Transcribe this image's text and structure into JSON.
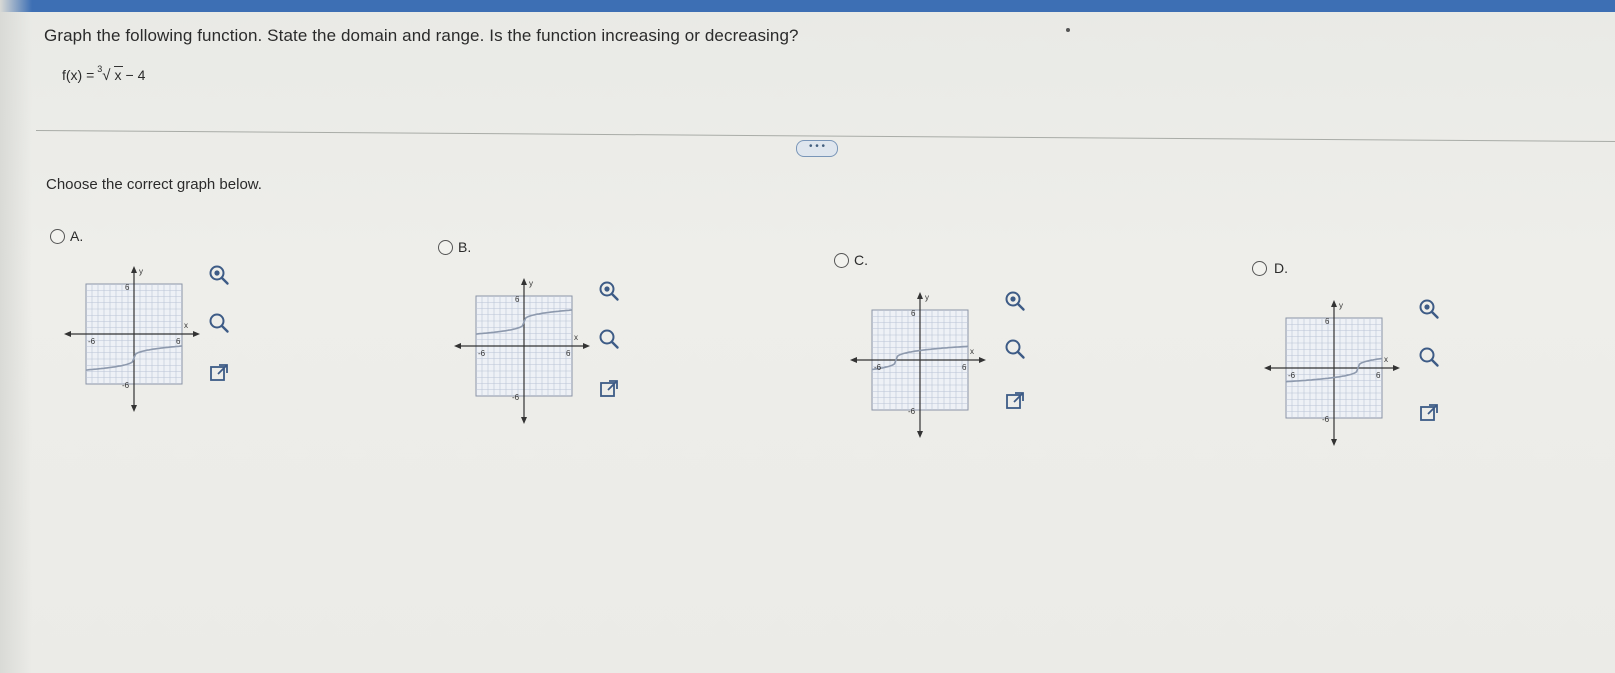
{
  "question": {
    "prompt": "Graph the following function. State the domain and range. Is the function increasing or decreasing?",
    "formula": {
      "lhs": "f(x) =",
      "root_index": "3",
      "radicand": "x",
      "rhs": "− 4"
    },
    "more_button": "• • •",
    "instruction": "Choose the correct graph below."
  },
  "options": [
    {
      "letter": "A.",
      "axis_x": "x",
      "axis_y": "y",
      "tick_pos": "6",
      "tick_neg": "-6"
    },
    {
      "letter": "B.",
      "axis_x": "x",
      "axis_y": "y",
      "tick_pos": "6",
      "tick_neg": "-6"
    },
    {
      "letter": "C.",
      "axis_x": "x",
      "axis_y": "y",
      "tick_pos": "6",
      "tick_neg": "-6"
    },
    {
      "letter": "D.",
      "axis_x": "x",
      "axis_y": "y",
      "tick_pos": "6",
      "tick_neg": "-6"
    }
  ],
  "icons": {
    "zoom_in": "zoom-in-icon",
    "zoom_out": "zoom-out-icon",
    "popout": "popout-icon"
  },
  "colors": {
    "accent": "#3d6fb4",
    "icon": "#3d5b86",
    "grid": "#b9c4d6",
    "curve": "#8d99ad"
  }
}
